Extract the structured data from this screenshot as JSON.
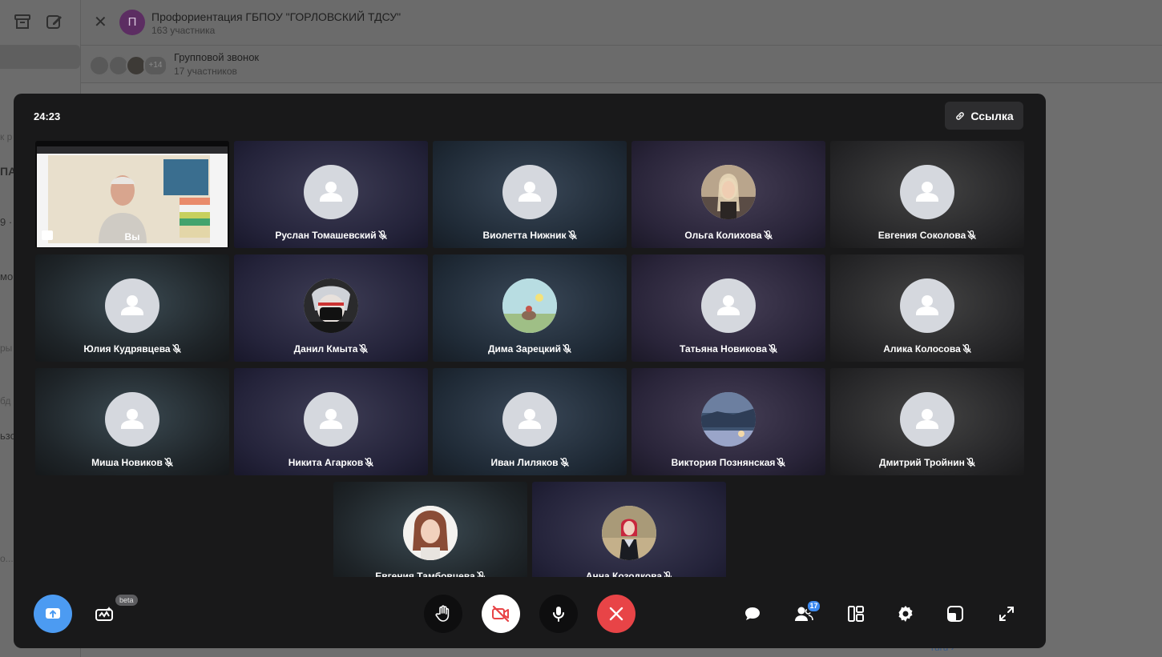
{
  "background": {
    "chat_title": "Профориентация ГБПОУ \"ГОРЛОВСКИЙ ТДСУ\"",
    "chat_avatar_letter": "П",
    "chat_members": "163 участника",
    "call_bar_title": "Групповой звонок",
    "call_bar_members": "17 участников",
    "call_bar_more": "+14",
    "sidebar_fragments": [
      "к р",
      "ПА",
      "9 ·",
      "мо",
      "ры :",
      "бд",
      "ьзо",
      "о..."
    ],
    "link_fragment": "ruru ›"
  },
  "call": {
    "timer": "24:23",
    "link_label": "Ссылка",
    "participants_badge": "17",
    "beta_label": "beta",
    "tiles": [
      {
        "name": "Вы",
        "avatar": "video",
        "muted": false
      },
      {
        "name": "Руслан Томашевский",
        "avatar": "placeholder",
        "muted": true
      },
      {
        "name": "Виолетта Нижник",
        "avatar": "placeholder",
        "muted": true
      },
      {
        "name": "Ольга Колихова",
        "avatar": "photo-girl-light",
        "muted": true
      },
      {
        "name": "Евгения Соколова",
        "avatar": "placeholder",
        "muted": true
      },
      {
        "name": "Юлия Кудрявцева",
        "avatar": "placeholder",
        "muted": true
      },
      {
        "name": "Данил Кмыта",
        "avatar": "photo-anime-mask",
        "muted": true
      },
      {
        "name": "Дима Зарецкий",
        "avatar": "photo-landscape",
        "muted": true
      },
      {
        "name": "Татьяна Новикова",
        "avatar": "placeholder",
        "muted": true
      },
      {
        "name": "Алика Колосова",
        "avatar": "placeholder",
        "muted": true
      },
      {
        "name": "Миша Новиков",
        "avatar": "placeholder",
        "muted": true
      },
      {
        "name": "Никита Агарков",
        "avatar": "placeholder",
        "muted": true
      },
      {
        "name": "Иван Лиляков",
        "avatar": "placeholder",
        "muted": true
      },
      {
        "name": "Виктория Познянская",
        "avatar": "photo-sky",
        "muted": true
      },
      {
        "name": "Дмитрий Тройнин",
        "avatar": "placeholder",
        "muted": true
      },
      {
        "name": "Евгения Тамбовцева",
        "avatar": "photo-girl-dark",
        "muted": true
      },
      {
        "name": "Анна Козодкова",
        "avatar": "photo-red-hair",
        "muted": true
      }
    ]
  },
  "colors": {
    "call_bg": "#19191a",
    "share_button": "#4c9bf2",
    "end_call": "#e84447",
    "avatar_placeholder": "#d5d8de"
  },
  "icons": [
    "archive-icon",
    "compose-icon",
    "close-icon",
    "link-icon",
    "mic-off-icon",
    "screen-share-icon",
    "effects-icon",
    "raise-hand-icon",
    "camera-off-icon",
    "mic-icon",
    "end-call-icon",
    "chat-icon",
    "participants-icon",
    "layout-icon",
    "settings-icon",
    "pip-icon",
    "fullscreen-icon"
  ]
}
